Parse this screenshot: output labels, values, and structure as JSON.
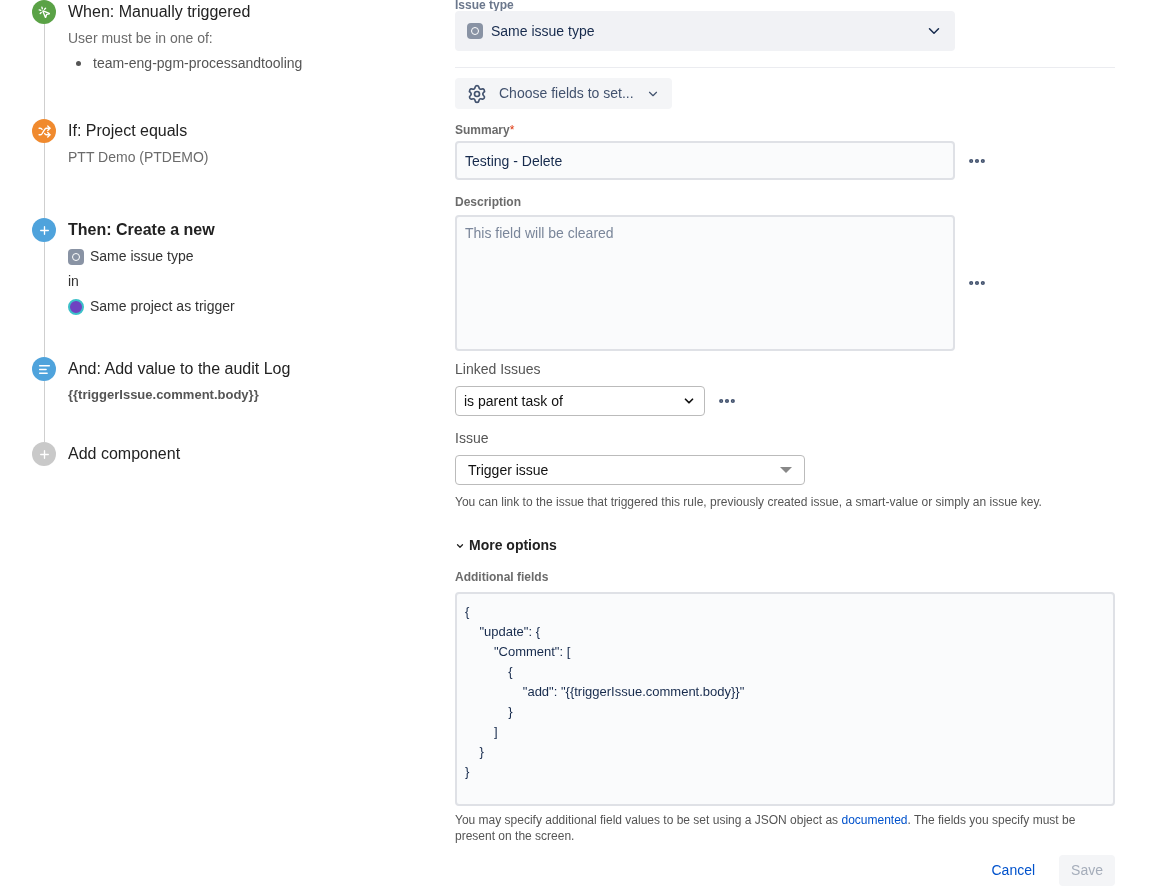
{
  "steps": [
    {
      "kind": "trigger",
      "title": "When: Manually triggered",
      "emphasized": false,
      "lines": [
        {
          "kind": "text",
          "text": "User must be in one of:"
        },
        {
          "kind": "bullet",
          "text": "team-eng-pgm-processandtooling"
        }
      ]
    },
    {
      "kind": "condition",
      "title": "If: Project equals",
      "emphasized": false,
      "lines": [
        {
          "kind": "text",
          "text": "PTT Demo (PTDEMO)"
        }
      ]
    },
    {
      "kind": "action",
      "title": "Then: Create a new",
      "emphasized": true,
      "lines": [
        {
          "kind": "issuetype",
          "text": "Same issue type"
        },
        {
          "kind": "plain",
          "text": "in"
        },
        {
          "kind": "project",
          "text": "Same project as trigger"
        }
      ]
    },
    {
      "kind": "log",
      "title": "And: Add value to the audit Log",
      "emphasized": false,
      "lines": [
        {
          "kind": "code",
          "text": "{{triggerIssue.comment.body}}"
        }
      ]
    },
    {
      "kind": "add",
      "title": "Add component",
      "emphasized": false
    }
  ],
  "form": {
    "issue_type": {
      "label": "Issue type",
      "value": "Same issue type"
    },
    "choose_fields": "Choose fields to set...",
    "summary": {
      "label": "Summary",
      "required_mark": "*",
      "value": "Testing - Delete"
    },
    "description": {
      "label": "Description",
      "placeholder": "This field will be cleared"
    },
    "linked_issues": {
      "label": "Linked Issues",
      "value": "is parent task of"
    },
    "issue": {
      "label": "Issue",
      "value": "Trigger issue",
      "help": "You can link to the issue that triggered this rule, previously created issue, a smart-value or simply an issue key."
    },
    "more_options": {
      "label": "More options",
      "expanded": true
    },
    "additional_fields": {
      "label": "Additional fields",
      "value": "{\n    \"update\": {\n        \"Comment\": [\n            {\n                \"add\": \"{{triggerIssue.comment.body}}\"\n            }\n        ]\n    }\n}",
      "help_before": "You may specify additional field values to be set using a JSON object as ",
      "help_link": "documented",
      "help_after": ". The fields you specify must be present on the screen."
    },
    "buttons": [
      {
        "label": "Cancel",
        "kind": "link",
        "disabled": false
      },
      {
        "label": "Save",
        "kind": "primary",
        "disabled": true
      }
    ]
  }
}
